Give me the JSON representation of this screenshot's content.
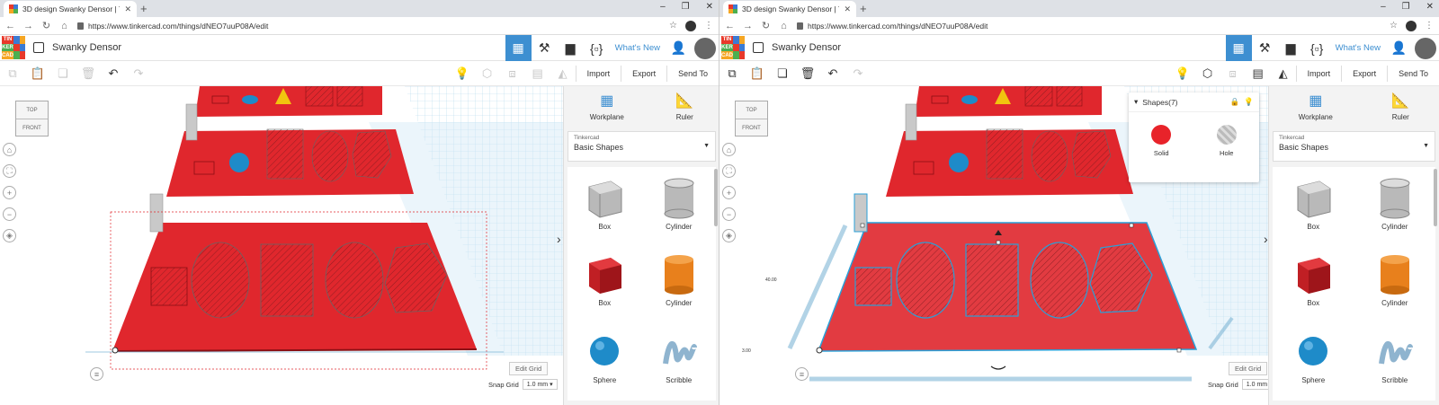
{
  "browser": {
    "tab_title": "3D design Swanky Densor | Tinke",
    "url": "https://www.tinkercad.com/things/dNEO7uuP08A/edit"
  },
  "app": {
    "logo_letters": [
      "TIN",
      "KER",
      "CAD"
    ],
    "design_title": "Swanky Densor",
    "whats_new": "What's New"
  },
  "toolbar": {
    "import_label": "Import",
    "export_label": "Export",
    "send_to_label": "Send To"
  },
  "viewcube": {
    "top_label": "TOP",
    "front_label": "FRONT"
  },
  "canvas": {
    "edit_grid_label": "Edit Grid",
    "snap_grid_label": "Snap Grid",
    "snap_grid_value": "1.0 mm"
  },
  "panel": {
    "workplane_label": "Workplane",
    "ruler_label": "Ruler",
    "library_small": "Tinkercad",
    "library_name": "Basic Shapes",
    "shapes": [
      {
        "label": "Box",
        "kind": "box-hole",
        "color": "#b9b9b9"
      },
      {
        "label": "Cylinder",
        "kind": "cyl-hole",
        "color": "#b9b9b9"
      },
      {
        "label": "Box",
        "kind": "box",
        "color": "#d7262a"
      },
      {
        "label": "Cylinder",
        "kind": "cyl",
        "color": "#e8801c"
      },
      {
        "label": "Sphere",
        "kind": "sphere",
        "color": "#1e8bc9"
      },
      {
        "label": "Scribble",
        "kind": "scribble",
        "color": "#8fb4cf"
      }
    ]
  },
  "inspector": {
    "title": "Shapes(7)",
    "solid_label": "Solid",
    "hole_label": "Hole",
    "solid_color": "#e8232a"
  },
  "dimensions": {
    "side_value": "40.00",
    "height_value": "3.00"
  },
  "colors": {
    "accent": "#3d8fd1",
    "plate_red": "#e0272d",
    "grid_blue": "#a9d3ea"
  }
}
